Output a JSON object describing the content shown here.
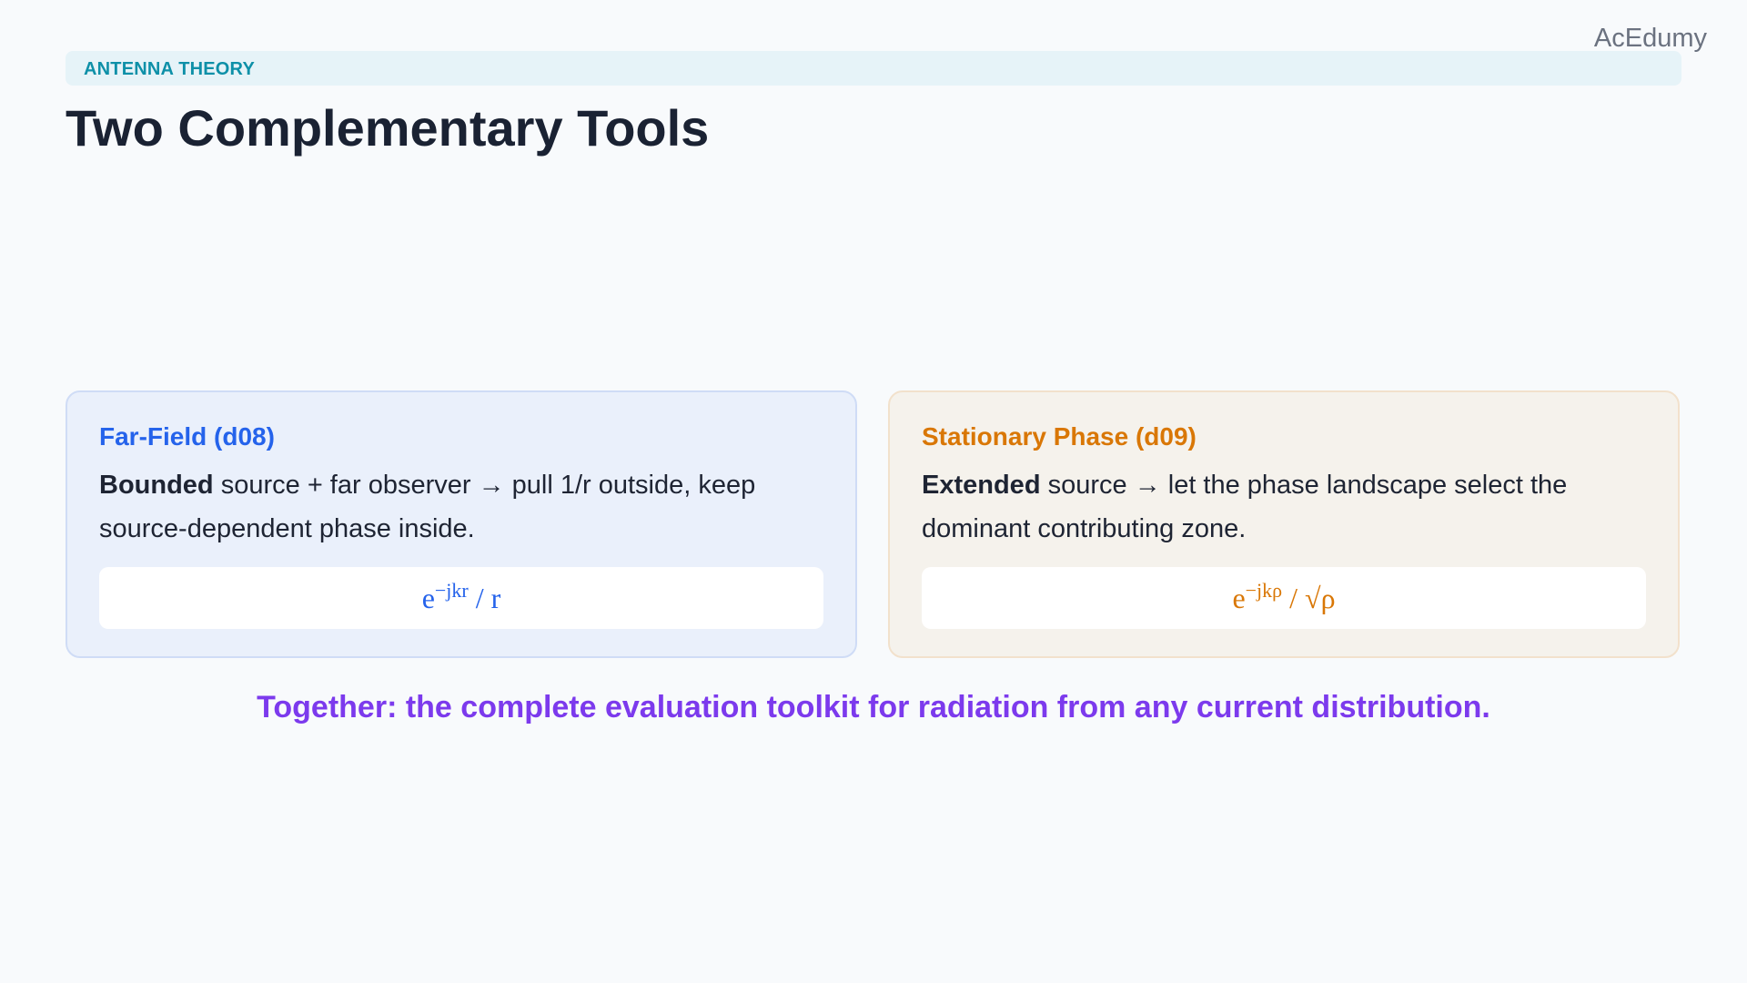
{
  "brand": "AcEdumy",
  "section": "ANTENNA THEORY",
  "title": "Two Complementary Tools",
  "cards": [
    {
      "title": "Far-Field (d08)",
      "lead": "Bounded",
      "text": " source + far observer → pull 1/r outside, keep source-dependent phase inside.",
      "formula": {
        "base": "e",
        "exponent": "−jkr",
        "rest": " / r"
      }
    },
    {
      "title": "Stationary Phase (d09)",
      "lead": "Extended",
      "text": " source → let the phase landscape select the dominant contributing zone.",
      "formula": {
        "base": "e",
        "exponent": "−jkρ",
        "rest": " / √ρ"
      }
    }
  ],
  "summary": "Together: the complete evaluation toolkit for radiation from any current distribution.",
  "colors": {
    "background": "#f8fafc",
    "section_bar": "#e6f3f8",
    "section_text": "#0e90a8",
    "title_text": "#1a2233",
    "card_blue_accent": "#2563eb",
    "card_blue_bg": "#eaf0fb",
    "card_orange_accent": "#d97706",
    "card_orange_bg": "#f5f2ec",
    "summary_text": "#7c3aed"
  }
}
